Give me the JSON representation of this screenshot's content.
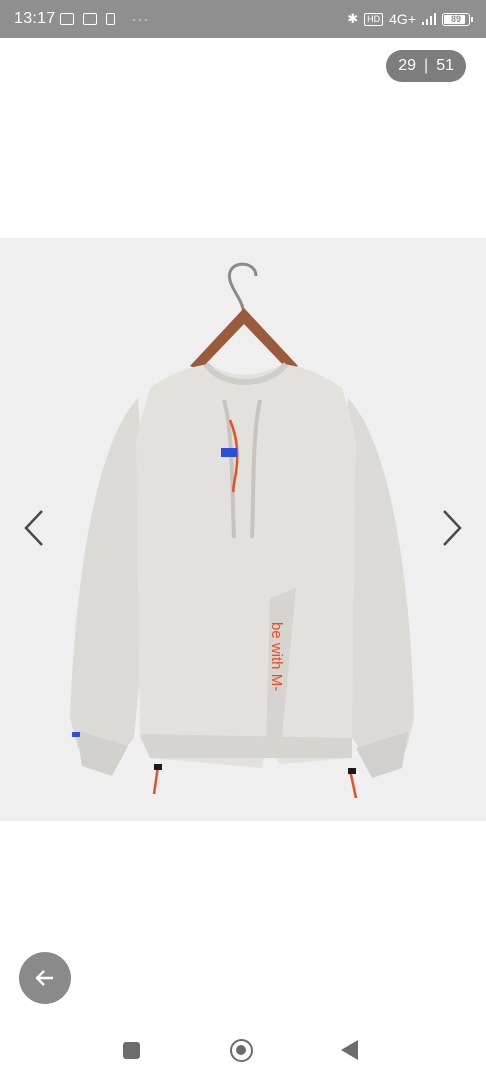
{
  "status_bar": {
    "time": "13:17",
    "network": "4G+",
    "hd_label": "HD",
    "battery": "89",
    "overflow_dots": "···"
  },
  "viewer": {
    "current_index": "29",
    "separator": "|",
    "total_count": "51",
    "image": {
      "print_text": "be with M-"
    }
  },
  "icons": {
    "prev": "chevron-left-icon",
    "next": "chevron-right-icon",
    "back": "arrow-left-icon",
    "nav_recents": "square-icon",
    "nav_home": "circle-icon",
    "nav_back": "triangle-back-icon"
  },
  "colors": {
    "status_bar_bg": "#8f8f8f",
    "counter_bg": "#7d7d7d",
    "fab_bg": "#8a8a8a",
    "accent_orange": "#e8501e",
    "tag_blue": "#2b4fd6"
  }
}
